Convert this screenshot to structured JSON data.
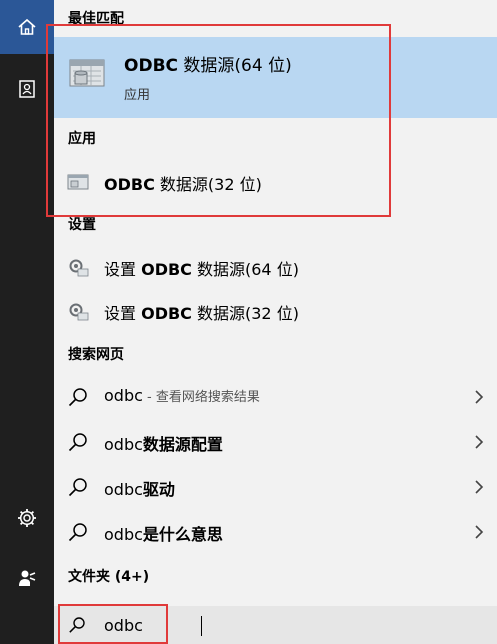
{
  "sections": {
    "best_match": "最佳匹配",
    "apps": "应用",
    "settings": "设置",
    "web": "搜索网页",
    "folders": "文件夹 (4+)"
  },
  "best_match": {
    "title_bold": "ODBC",
    "title_rest": " 数据源(64 位)",
    "subtitle": "应用"
  },
  "apps": [
    {
      "bold": "ODBC",
      "rest": " 数据源(32 位)"
    }
  ],
  "settings_items": [
    {
      "pre": "设置 ",
      "bold": "ODBC",
      "rest": " 数据源(64 位)"
    },
    {
      "pre": "设置 ",
      "bold": "ODBC",
      "rest": " 数据源(32 位)"
    }
  ],
  "web_items": [
    {
      "pre": "odbc",
      "hint": " - 查看网络搜索结果",
      "bold": ""
    },
    {
      "pre": "odbc",
      "bold": "数据源配置",
      "hint": ""
    },
    {
      "pre": "odbc",
      "bold": "驱动",
      "hint": ""
    },
    {
      "pre": "odbc",
      "bold": "是什么意思",
      "hint": ""
    }
  ],
  "search": {
    "value": "odbc"
  },
  "colors": {
    "rail": "#1f1f1f",
    "rail_active": "#2b5797",
    "selection": "#b9d7f2",
    "highlight": "#e03a3a"
  },
  "icons": [
    "home-icon",
    "contact-card-icon",
    "gear-icon",
    "person-icon",
    "odbc-app-icon",
    "settings-gear-icon",
    "search-icon",
    "chevron-right-icon"
  ]
}
